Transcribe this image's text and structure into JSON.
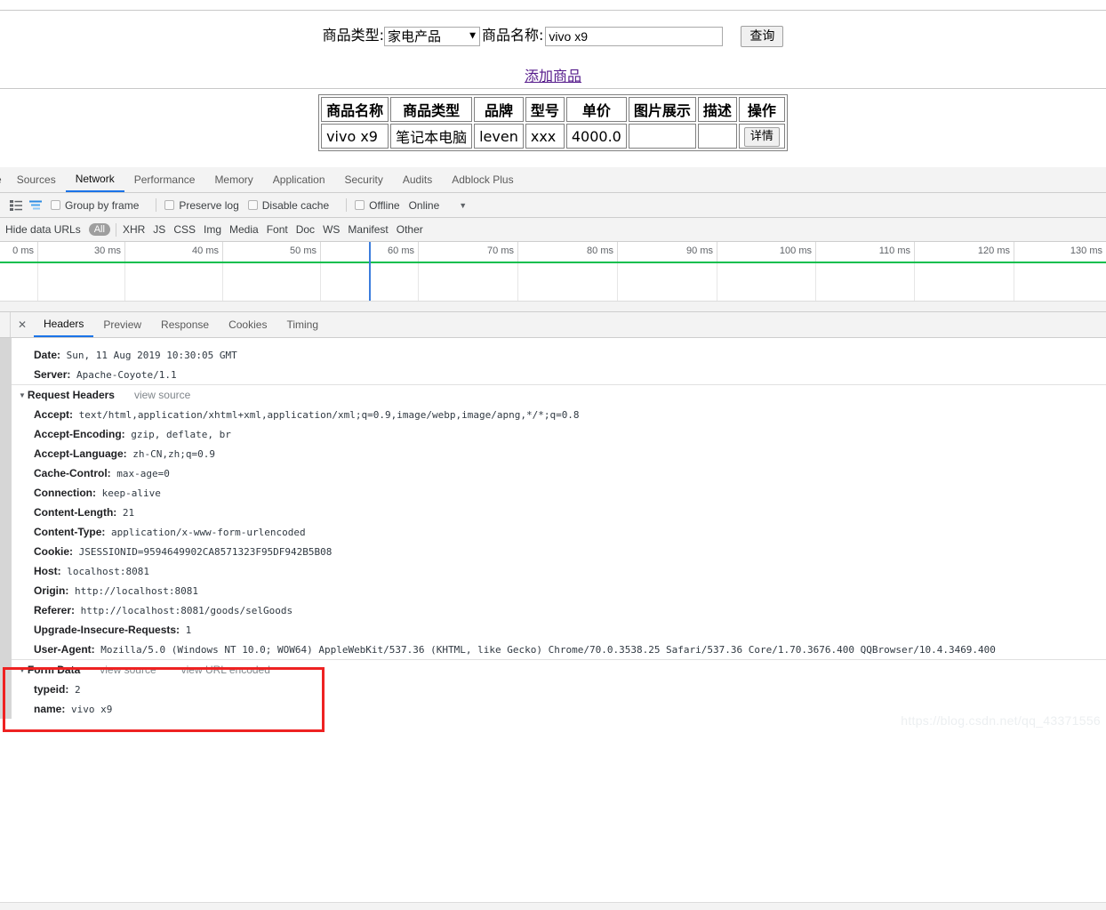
{
  "page": {
    "search_form": {
      "type_label": "商品类型:",
      "type_value": "家电产品",
      "name_label": "商品名称:",
      "name_value": "vivo x9",
      "name_placeholder": "",
      "query_button": "查询"
    },
    "add_link": "添加商品",
    "table": {
      "headers": [
        "商品名称",
        "商品类型",
        "品牌",
        "型号",
        "单价",
        "图片展示",
        "描述",
        "操作"
      ],
      "rows": [
        {
          "name": "vivo x9",
          "type": "笔记本电脑",
          "brand": "leven",
          "model": "xxx",
          "price": "4000.0",
          "image": "",
          "desc": "",
          "action": "详情"
        }
      ]
    }
  },
  "devtools": {
    "main_tabs": [
      {
        "label": "e",
        "active": false,
        "clipped": true
      },
      {
        "label": "Sources",
        "active": false
      },
      {
        "label": "Network",
        "active": true
      },
      {
        "label": "Performance",
        "active": false
      },
      {
        "label": "Memory",
        "active": false
      },
      {
        "label": "Application",
        "active": false
      },
      {
        "label": "Security",
        "active": false
      },
      {
        "label": "Audits",
        "active": false
      },
      {
        "label": "Adblock Plus",
        "active": false
      }
    ],
    "toolbar": {
      "checkboxes": [
        {
          "label": "Group by frame"
        },
        {
          "label": "Preserve log"
        },
        {
          "label": "Disable cache"
        },
        {
          "label": "Offline"
        }
      ],
      "throttle_value": "Online",
      "caret": "▼"
    },
    "filterbar": {
      "hide_data_urls": "Hide data URLs",
      "all": "All",
      "types": [
        "XHR",
        "JS",
        "CSS",
        "Img",
        "Media",
        "Font",
        "Doc",
        "WS",
        "Manifest",
        "Other"
      ]
    },
    "timeline": {
      "ticks": [
        "0 ms",
        "30 ms",
        "40 ms",
        "50 ms",
        "60 ms",
        "70 ms",
        "80 ms",
        "90 ms",
        "100 ms",
        "110 ms",
        "120 ms",
        "130 ms"
      ],
      "event_line_color": "#0bbf4e",
      "marker_color": "#3b7ddd"
    },
    "detail": {
      "close_icon": "✕",
      "tabs": [
        {
          "label": "Headers",
          "active": true
        },
        {
          "label": "Preview",
          "active": false
        },
        {
          "label": "Response",
          "active": false
        },
        {
          "label": "Cookies",
          "active": false
        },
        {
          "label": "Timing",
          "active": false
        }
      ],
      "response_headers_visible": [
        {
          "key": "Date:",
          "value": "Sun, 11 Aug 2019 10:30:05 GMT"
        },
        {
          "key": "Server:",
          "value": "Apache-Coyote/1.1"
        }
      ],
      "request_headers_section": {
        "title": "Request Headers",
        "triangle": "▼",
        "view_source": "view source"
      },
      "request_headers": [
        {
          "key": "Accept:",
          "value": "text/html,application/xhtml+xml,application/xml;q=0.9,image/webp,image/apng,*/*;q=0.8"
        },
        {
          "key": "Accept-Encoding:",
          "value": "gzip, deflate, br"
        },
        {
          "key": "Accept-Language:",
          "value": "zh-CN,zh;q=0.9"
        },
        {
          "key": "Cache-Control:",
          "value": "max-age=0"
        },
        {
          "key": "Connection:",
          "value": "keep-alive"
        },
        {
          "key": "Content-Length:",
          "value": "21"
        },
        {
          "key": "Content-Type:",
          "value": "application/x-www-form-urlencoded"
        },
        {
          "key": "Cookie:",
          "value": "JSESSIONID=9594649902CA8571323F95DF942B5B08"
        },
        {
          "key": "Host:",
          "value": "localhost:8081"
        },
        {
          "key": "Origin:",
          "value": "http://localhost:8081"
        },
        {
          "key": "Referer:",
          "value": "http://localhost:8081/goods/selGoods"
        },
        {
          "key": "Upgrade-Insecure-Requests:",
          "value": "1"
        },
        {
          "key": "User-Agent:",
          "value": "Mozilla/5.0 (Windows NT 10.0; WOW64) AppleWebKit/537.36 (KHTML, like Gecko) Chrome/70.0.3538.25 Safari/537.36 Core/1.70.3676.400 QQBrowser/10.4.3469.400"
        }
      ],
      "form_data_section": {
        "title": "Form Data",
        "triangle": "▼",
        "view_source": "view source",
        "view_url_encoded": "view URL encoded"
      },
      "form_data": [
        {
          "key": "typeid:",
          "value": "2"
        },
        {
          "key": "name:",
          "value": "vivo x9"
        }
      ],
      "highlight_color": "#ee2222"
    }
  },
  "watermark": "https://blog.csdn.net/qq_43371556"
}
